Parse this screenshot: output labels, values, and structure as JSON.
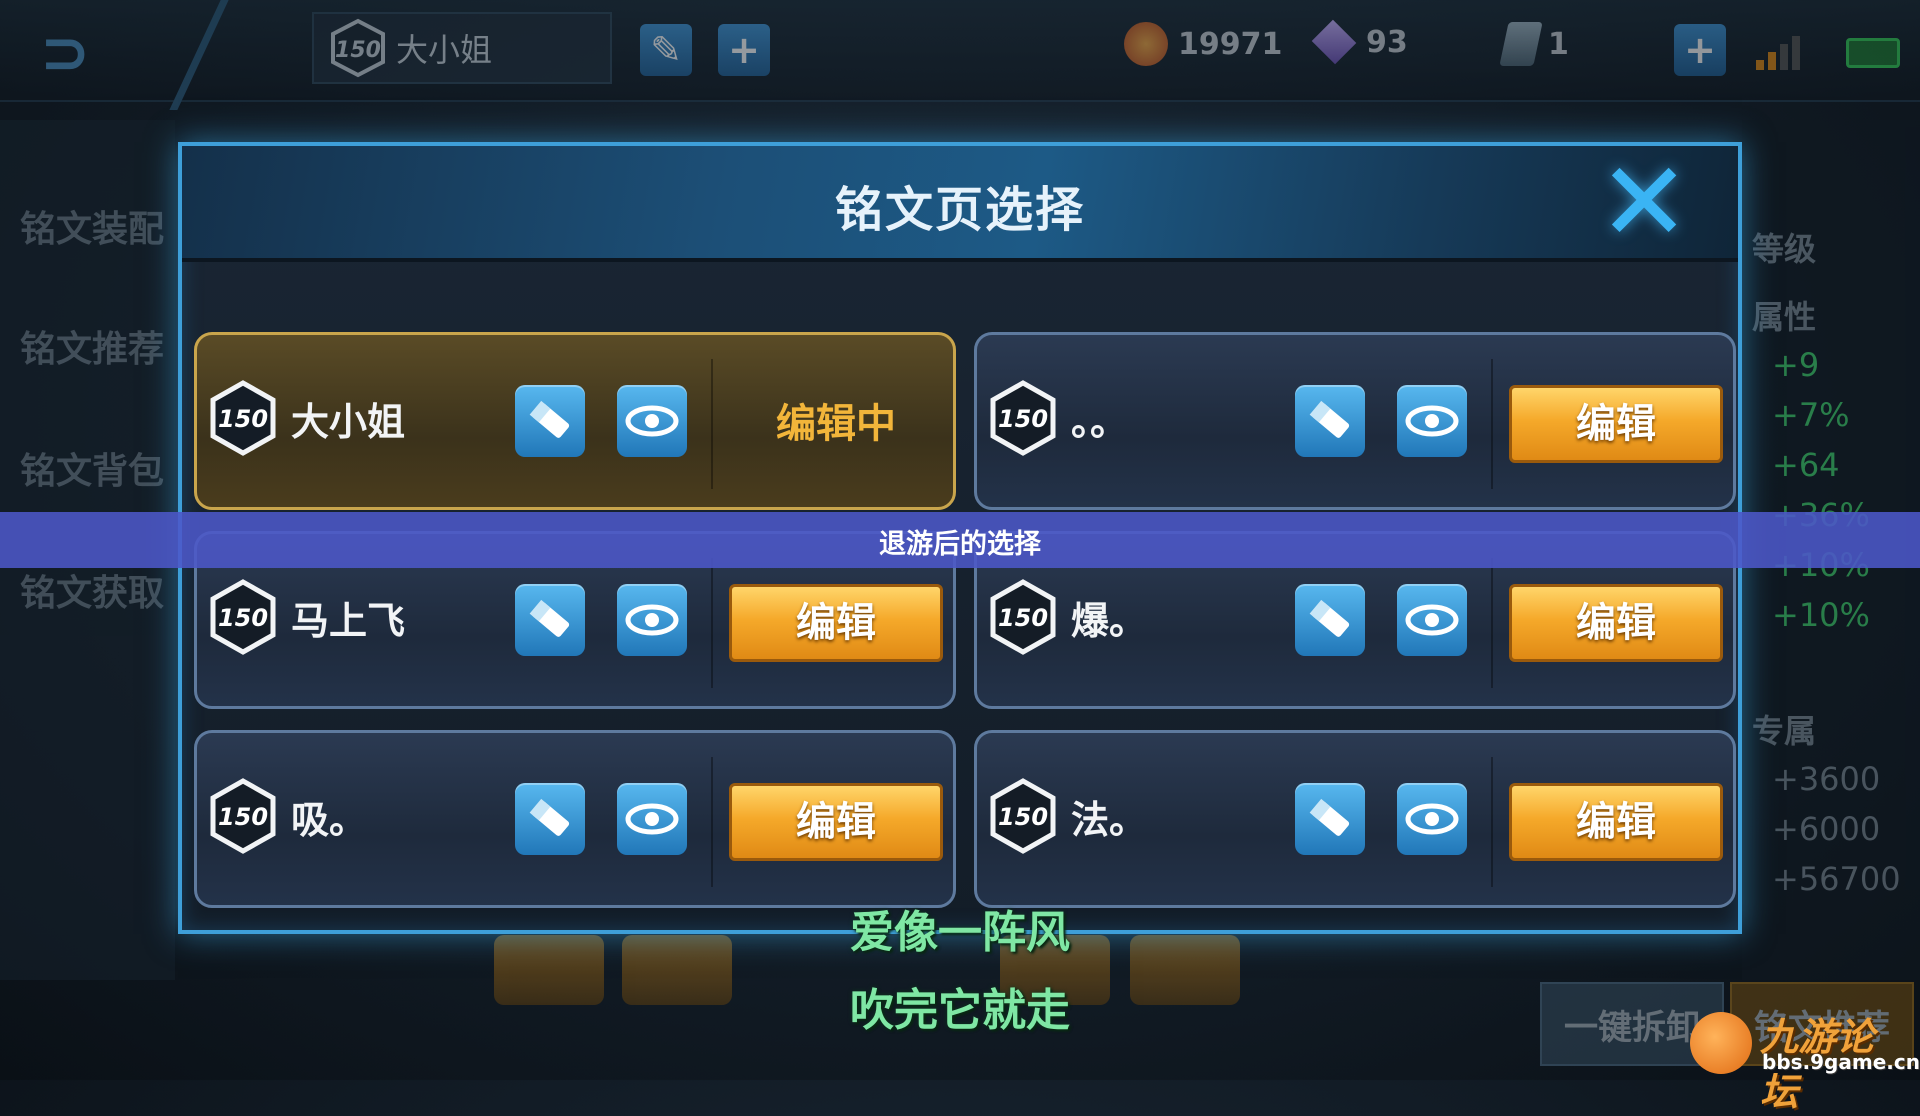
{
  "topbar": {
    "back_icon": "back-arrow-icon",
    "rune_page_chip": {
      "level": "150",
      "name": "大小姐"
    },
    "buttons": [
      {
        "name": "rename-icon"
      },
      {
        "name": "add-page-icon",
        "label": "+"
      }
    ],
    "currencies": [
      {
        "name": "gold-coin",
        "value": "19971"
      },
      {
        "name": "diamond",
        "value": "93"
      },
      {
        "name": "rune-card",
        "value": "1"
      }
    ],
    "add_currency_label": "+"
  },
  "sidebar": {
    "items": [
      "铭文装配",
      "铭文推荐",
      "铭文背包",
      "铭文获取"
    ]
  },
  "right_panel": {
    "level_label": "等级",
    "attr_label": "属性",
    "attr_values": [
      "+9",
      "+7%",
      "+64",
      "+36%",
      "+10%",
      "+10%"
    ],
    "exclusive_label": "专属",
    "exclusive_values": [
      "+3600",
      "+6000",
      "+56700"
    ]
  },
  "bottom_bar": {
    "disassemble_label": "一键拆卸",
    "extra_label": "铭文推荐"
  },
  "modal": {
    "title": "铭文页选择",
    "close_icon": "close-x-icon",
    "slots": [
      {
        "level": "150",
        "name": "大小姐",
        "status": "编辑中",
        "active": true
      },
      {
        "level": "150",
        "name": "。。",
        "button": "编辑",
        "active": false
      },
      {
        "level": "150",
        "name": "马上飞",
        "button": "编辑",
        "active": false
      },
      {
        "level": "150",
        "name": "爆。",
        "button": "编辑",
        "active": false
      },
      {
        "level": "150",
        "name": "吸。",
        "button": "编辑",
        "active": false
      },
      {
        "level": "150",
        "name": "法。",
        "button": "编辑",
        "active": false
      }
    ]
  },
  "overlay": {
    "banner": "退游后的选择",
    "subtitle_line1": "爱像一阵风",
    "subtitle_line2": "吹完它就走"
  },
  "watermark": {
    "title": "九游论坛",
    "url": "bbs.9game.cn"
  },
  "colors": {
    "modal_border": "#3e9fd9",
    "edit_button": "#f5a92a",
    "editing_text": "#f2b53a",
    "banner_bg": "#4c58c8",
    "subtitle": "#7fe7a4"
  }
}
